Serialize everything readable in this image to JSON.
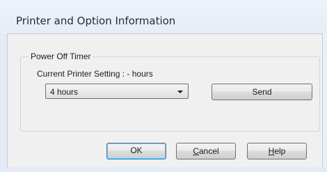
{
  "window": {
    "title": "Printer and Option Information"
  },
  "power_off_timer": {
    "group_label": "Power Off Timer",
    "current_setting_text": "Current Printer Setting : - hours",
    "dropdown_selected": "4 hours",
    "send_label": "Send"
  },
  "buttons": {
    "ok": "OK",
    "cancel": {
      "mnemonic": "C",
      "rest": "ancel"
    },
    "help": {
      "mnemonic": "H",
      "rest": "elp"
    }
  },
  "icons": {
    "dropdown": "chevron-down-icon"
  }
}
